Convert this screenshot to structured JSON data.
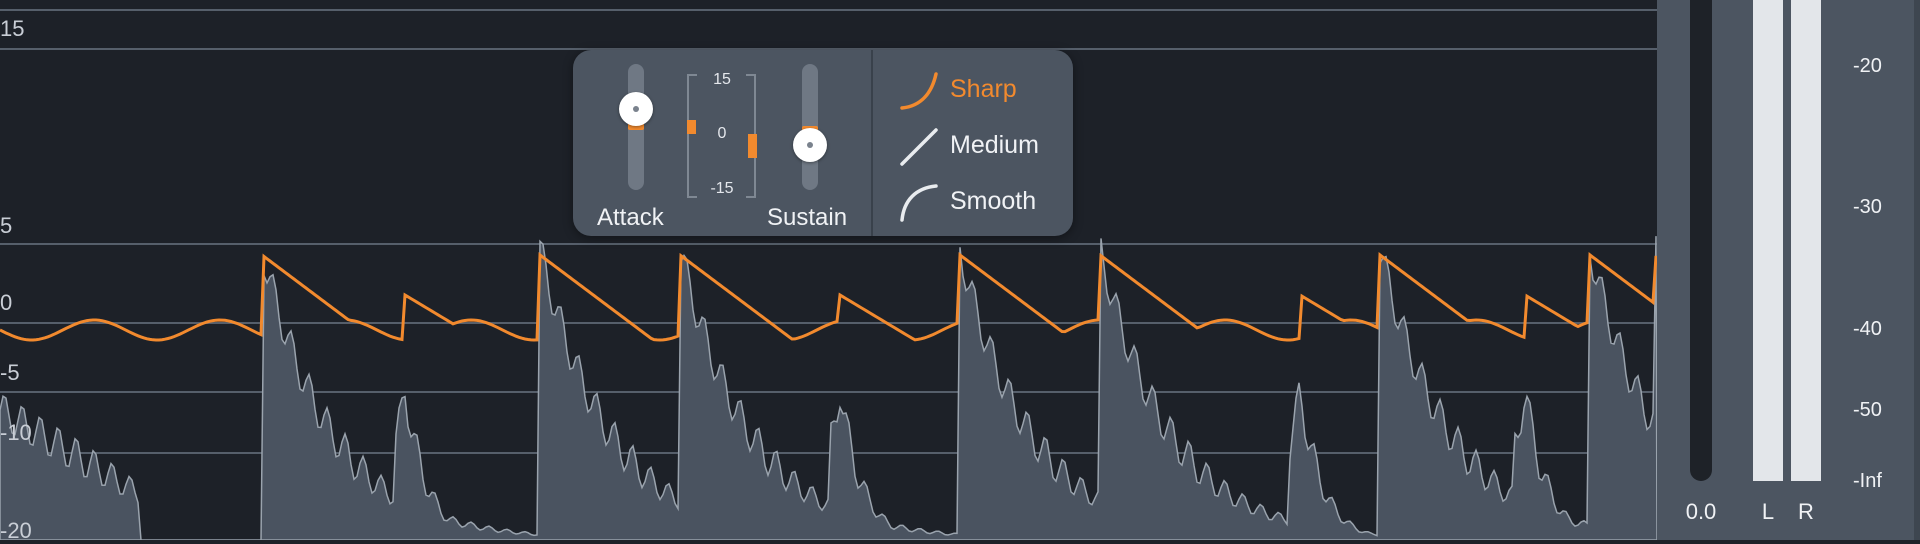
{
  "colors": {
    "background": "#1d2128",
    "accent": "#f28a2e",
    "panel": "#4c5561",
    "waveform": "#4a5360",
    "waveform_outline": "#9aa3ad"
  },
  "scale_labels": [
    "15",
    "5",
    "0",
    "-5",
    "-10",
    "-20"
  ],
  "panel": {
    "attack_label": "Attack",
    "sustain_label": "Sustain",
    "meter_top": "15",
    "meter_mid": "0",
    "meter_bottom": "-15",
    "curve_options": [
      {
        "label": "Sharp",
        "icon": "sharp-curve-icon",
        "active": true
      },
      {
        "label": "Medium",
        "icon": "medium-curve-icon",
        "active": false
      },
      {
        "label": "Smooth",
        "icon": "smooth-curve-icon",
        "active": false
      }
    ]
  },
  "meters": {
    "master_value": "0.0",
    "left_label": "L",
    "right_label": "R",
    "db_scale": [
      "-20",
      "-30",
      "-40",
      "-50",
      "-Inf"
    ]
  }
}
